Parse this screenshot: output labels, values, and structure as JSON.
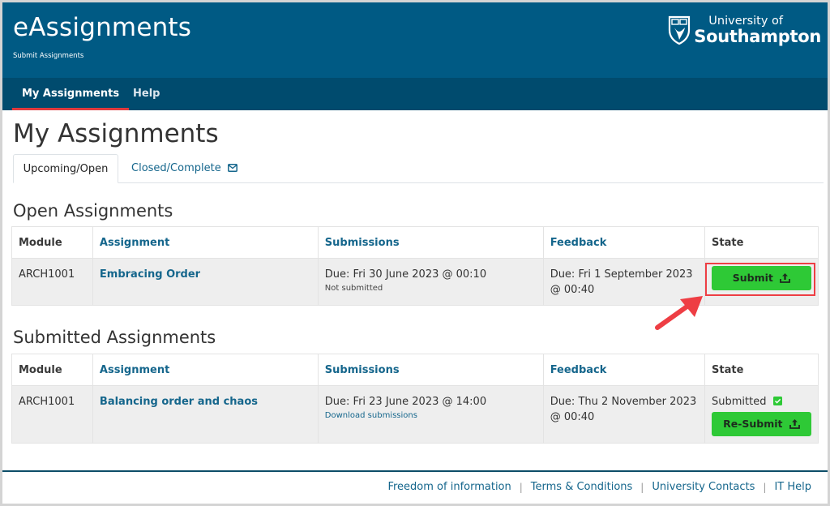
{
  "header": {
    "app_title": "eAssignments",
    "app_subtitle": "Submit Assignments",
    "logo": {
      "line1": "University of",
      "line2": "Southampton",
      "icon": "shield-crest-icon"
    },
    "bg_color": "#005a84"
  },
  "nav": {
    "items": [
      {
        "label": "My Assignments",
        "active": true
      },
      {
        "label": "Help",
        "active": false
      }
    ],
    "active_indicator_color": "#e03a3e"
  },
  "page_title": "My Assignments",
  "tabs": [
    {
      "label": "Upcoming/Open",
      "active": true
    },
    {
      "label": "Closed/Complete",
      "active": false,
      "icon": "envelope-icon"
    }
  ],
  "open_section": {
    "title": "Open Assignments",
    "columns": [
      "Module",
      "Assignment",
      "Submissions",
      "Feedback",
      "State"
    ],
    "rows": [
      {
        "module": "ARCH1001",
        "assignment": "Embracing Order",
        "submissions_due": "Due: Fri 30 June 2023 @ 00:10",
        "submissions_status": "Not submitted",
        "feedback_line1": "Due: Fri 1 September 2023",
        "feedback_line2": "@ 00:40",
        "action_label": "Submit",
        "action_icon": "upload-icon"
      }
    ]
  },
  "submitted_section": {
    "title": "Submitted Assignments",
    "columns": [
      "Module",
      "Assignment",
      "Submissions",
      "Feedback",
      "State"
    ],
    "rows": [
      {
        "module": "ARCH1001",
        "assignment": "Balancing order and chaos",
        "submissions_due": "Due: Fri 23 June 2023 @ 14:00",
        "submissions_link": "Download submissions",
        "feedback_line1": "Due: Thu 2 November 2023",
        "feedback_line2": "@ 00:40",
        "state_text": "Submitted",
        "state_icon": "checkbox-checked-icon",
        "action_label": "Re-Submit",
        "action_icon": "upload-icon"
      }
    ]
  },
  "colors": {
    "button_green": "#2ec936",
    "link_blue": "#15668c",
    "annotation_red": "#ee3e44"
  },
  "footer": {
    "links": [
      "Freedom of information",
      "Terms & Conditions",
      "University Contacts",
      "IT Help"
    ],
    "separator": "|"
  }
}
